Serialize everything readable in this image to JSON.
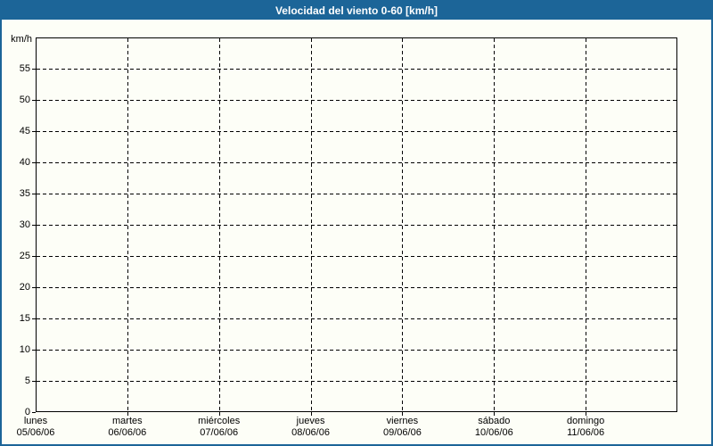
{
  "window": {
    "title": "Velocidad del viento 0-60 [km/h]"
  },
  "colors": {
    "accent_blue": "#1C6598",
    "background": "#FDFEF7",
    "grid": "#000000",
    "title_text": "#FFFFFF"
  },
  "chart_data": {
    "type": "line",
    "title": "Velocidad del viento 0-60 [km/h]",
    "ylabel": "km/h",
    "xlabel": "",
    "ylim": [
      0,
      60
    ],
    "ytick_step": 5,
    "yticks": [
      "0",
      "5",
      "10",
      "15",
      "20",
      "25",
      "30",
      "35",
      "40",
      "45",
      "50",
      "55"
    ],
    "grid": "dashed",
    "legend_position": "none",
    "days": [
      {
        "label": "lunes",
        "date": "05/06/06"
      },
      {
        "label": "martes",
        "date": "06/06/06"
      },
      {
        "label": "miércoles",
        "date": "07/06/06"
      },
      {
        "label": "jueves",
        "date": "08/06/06"
      },
      {
        "label": "viernes",
        "date": "09/06/06"
      },
      {
        "label": "sábado",
        "date": "10/06/06"
      },
      {
        "label": "domingo",
        "date": "11/06/06"
      }
    ],
    "series": [],
    "note": "plot area is empty - no data series drawn"
  }
}
